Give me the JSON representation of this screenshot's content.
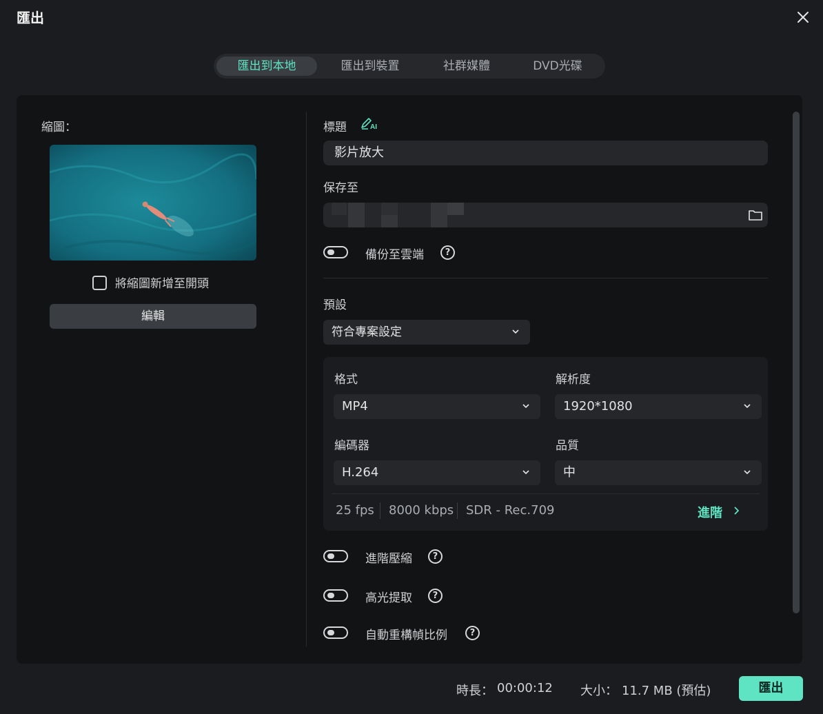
{
  "window": {
    "title": "匯出"
  },
  "tabs": [
    {
      "label": "匯出到本地",
      "active": true
    },
    {
      "label": "匯出到裝置",
      "active": false
    },
    {
      "label": "社群媒體",
      "active": false
    },
    {
      "label": "DVD光碟",
      "active": false
    }
  ],
  "thumbnail": {
    "label": "縮圖：",
    "add_to_start_label": "將縮圖新增至開頭",
    "edit_label": "編輯"
  },
  "form": {
    "title_label": "標題",
    "title_value": "影片放大",
    "save_to_label": "保存至",
    "backup_label": "備份至雲端",
    "preset_label": "預設",
    "preset_value": "符合專案設定"
  },
  "settings": {
    "format_label": "格式",
    "format_value": "MP4",
    "resolution_label": "解析度",
    "resolution_value": "1920*1080",
    "encoder_label": "編碼器",
    "encoder_value": "H.264",
    "quality_label": "品質",
    "quality_value": "中",
    "fps": "25 fps",
    "bitrate": "8000 kbps",
    "color": "SDR - Rec.709",
    "advanced_label": "進階"
  },
  "toggles": {
    "advanced_compression": "進階壓縮",
    "highlight_extract": "高光提取",
    "auto_reframe": "自動重構幀比例"
  },
  "footer": {
    "duration_label": "時長：",
    "duration_value": "00:00:12",
    "size_label": "大小：",
    "size_value": "11.7 MB (預估)",
    "export_label": "匯出"
  },
  "colors": {
    "accent": "#5ee3c3",
    "background": "#1b1c1f",
    "panel": "#121314"
  }
}
